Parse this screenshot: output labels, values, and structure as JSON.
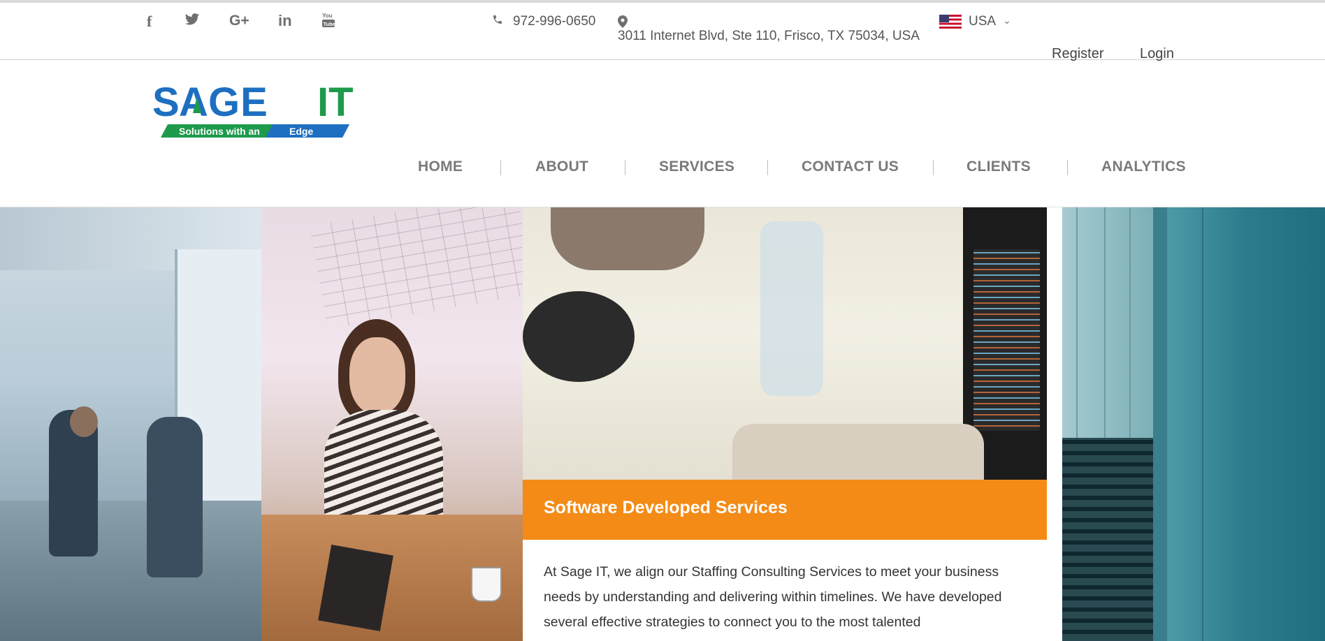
{
  "social": {
    "icons": [
      "facebook-icon",
      "twitter-icon",
      "google-plus-icon",
      "linkedin-icon",
      "youtube-icon"
    ],
    "glyphs": [
      "f",
      "🐦",
      "G+",
      "in",
      "▶"
    ]
  },
  "contact": {
    "phone": "972-996-0650",
    "address": "3011 Internet Blvd, Ste 110, Frisco, TX 75034, USA"
  },
  "country": {
    "selected": "USA"
  },
  "auth": {
    "register": "Register",
    "login": "Login"
  },
  "logo": {
    "title_part1": "SAGE",
    "title_part2": "IT",
    "tagline": "Solutions with an  Edge"
  },
  "nav": {
    "items": [
      "HOME",
      "ABOUT",
      "SERVICES",
      "CONTACT US",
      "CLIENTS",
      "ANALYTICS"
    ]
  },
  "feature": {
    "title": "Software Developed Services",
    "body": "At Sage IT, we align our Staffing Consulting Services to meet your business needs by understanding and delivering within timelines. We have developed several effective strategies to connect you to the most talented"
  },
  "colors": {
    "accent_orange": "#f38b16",
    "logo_blue": "#1e6fc1",
    "logo_green": "#1e9a4b"
  }
}
